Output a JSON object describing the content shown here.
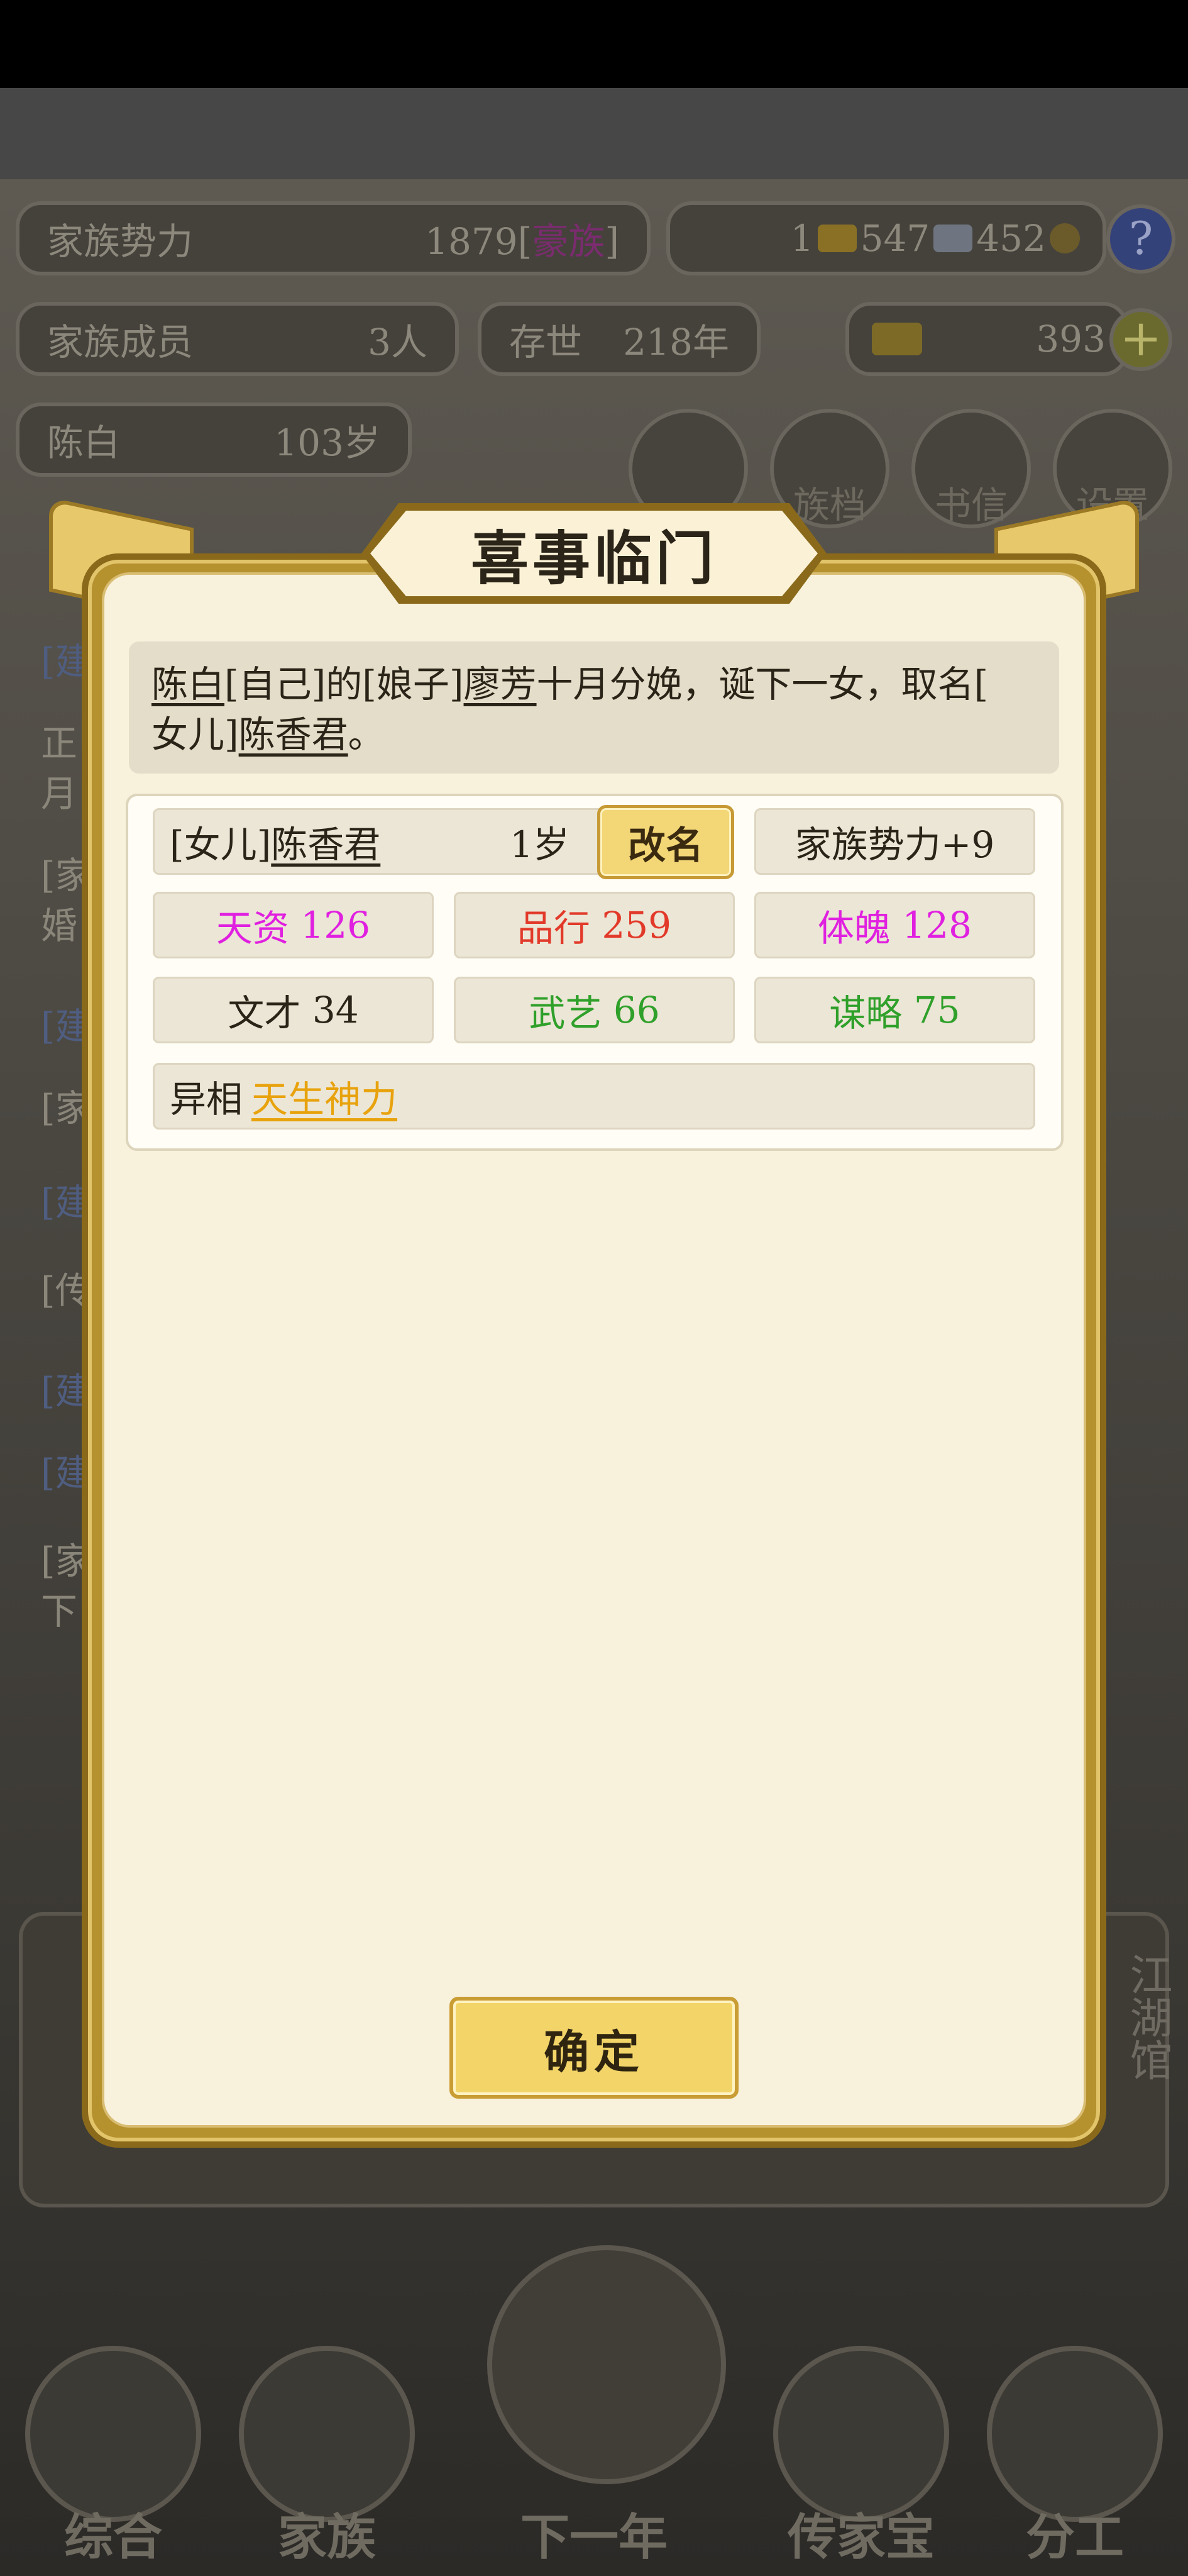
{
  "stats": {
    "power_label": "家族势力",
    "power_value": "1879",
    "power_bracket_open": "[",
    "power_rank": "豪族",
    "power_bracket_close": "]",
    "currency_gold": "1",
    "currency_silver": "547",
    "currency_ingot": "452",
    "help_symbol": "?",
    "members_label": "家族成员",
    "members_value": "3人",
    "era_label": "存世",
    "era_value": "218年",
    "yuanbao_value": "393",
    "plus_symbol": "+",
    "person_name": "陈白",
    "person_age": "103岁"
  },
  "top_buttons": [
    "",
    "族档",
    "书信",
    "设置"
  ],
  "background_rows": [
    "[建",
    "正",
    "月",
    "[家",
    "婚",
    "[建",
    "[家",
    "[建",
    "[传",
    "[建",
    "[建",
    "[家",
    "下"
  ],
  "background_side": "江湖馆",
  "bottom_nav": [
    "综合",
    "家族",
    "下一年",
    "传家宝",
    "分工"
  ],
  "modal": {
    "title": "喜事临门",
    "message": {
      "p1": "陈白",
      "p2": "[自己]的[娘子]",
      "p3": "廖芳",
      "p4": "十月分娩，诞下一女，取名[",
      "p5": "女儿]",
      "p6": "陈香君",
      "p7": "。"
    },
    "child": {
      "name_prefix": "[女儿]",
      "name": "陈香君",
      "age": "1岁",
      "rename_label": "改名",
      "power_bonus": "家族势力+9"
    },
    "attributes": [
      {
        "label": "天资",
        "value": "126",
        "color": "#e020e0"
      },
      {
        "label": "品行",
        "value": "259",
        "color": "#e23a2a"
      },
      {
        "label": "体魄",
        "value": "128",
        "color": "#e020e0"
      },
      {
        "label": "文才",
        "value": "34",
        "color": "#2a2418"
      },
      {
        "label": "武艺",
        "value": "66",
        "color": "#2fa02a"
      },
      {
        "label": "谋略",
        "value": "75",
        "color": "#2fa02a"
      }
    ],
    "trait": {
      "label": "异相",
      "value": "天生神力",
      "color": "#e8a20c"
    },
    "confirm_label": "确定"
  }
}
